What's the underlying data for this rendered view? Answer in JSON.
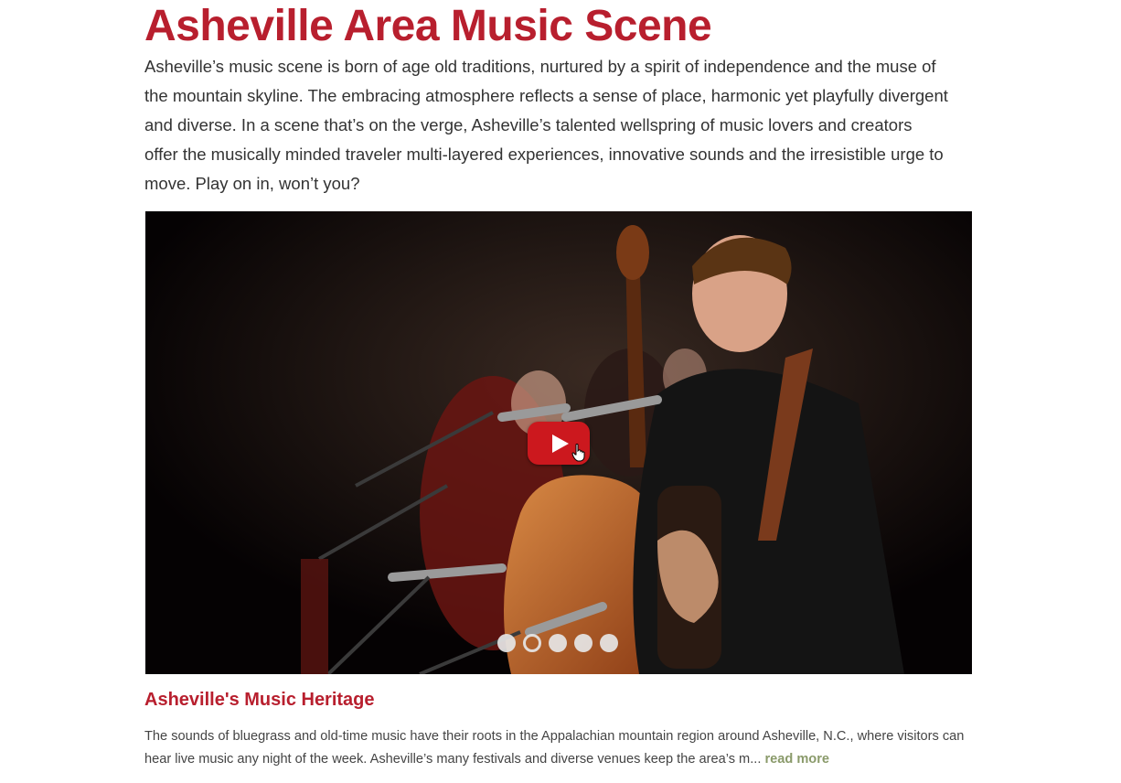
{
  "header": {
    "title": "Asheville Area Music Scene"
  },
  "intro": {
    "text": "Asheville’s music scene is born of age old traditions, nurtured by a spirit of independence and the muse of the mountain skyline. The embracing atmosphere reflects a sense of place, harmonic yet playfully divergent and diverse. In a scene that’s on the verge, Asheville’s talented wellspring of music lovers and creators offer the musically minded traveler multi-layered experiences, innovative sounds and the irresistible urge to move. Play on in, won’t you?"
  },
  "carousel": {
    "slide_count": 5,
    "active_slide": 2,
    "colors": {
      "play_button": "#cc181e",
      "dot": "#e6e6e6"
    }
  },
  "feature": {
    "title": "Asheville's Music Heritage",
    "text": "The sounds of bluegrass and old-time music have their roots in the Appalachian mountain region around Asheville, N.C., where visitors can hear live music any night of the week. Asheville’s many festivals and diverse venues keep the area’s m...",
    "read_more": "read more"
  },
  "colors": {
    "accent": "#b81f2e",
    "read_more": "#8a9a6a"
  },
  "icons": {
    "play": "play-icon",
    "pointer": "hand-pointer-icon"
  }
}
